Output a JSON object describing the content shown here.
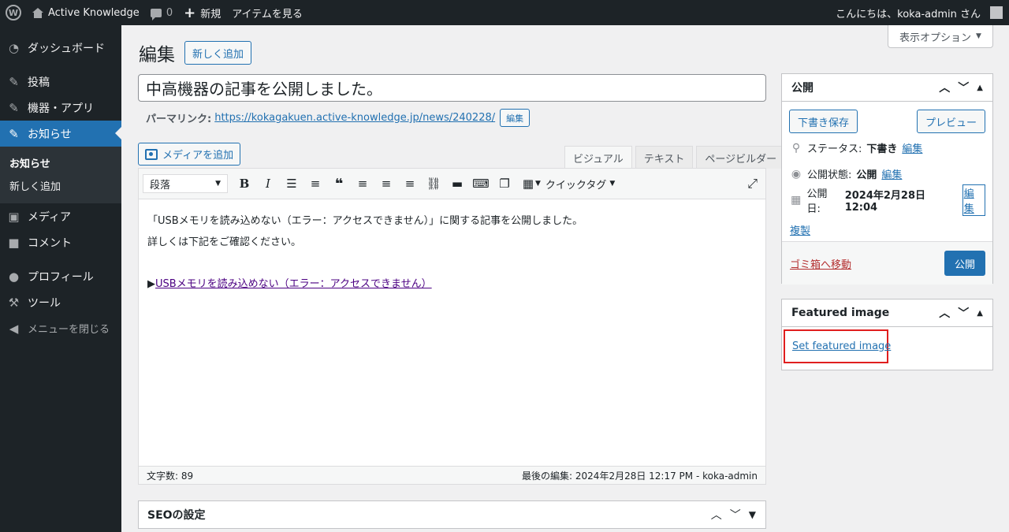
{
  "adminbar": {
    "site_name": "Active Knowledge",
    "comments_count": "0",
    "new_label": "新規",
    "view_label": "アイテムを見る",
    "greeting": "こんにちは、koka-admin さん"
  },
  "sidebar": {
    "items": [
      {
        "label": "ダッシュボード",
        "icon": "dashboard-icon"
      },
      {
        "label": "投稿",
        "icon": "pin-icon"
      },
      {
        "label": "機器・アプリ",
        "icon": "pin-icon"
      },
      {
        "label": "お知らせ",
        "icon": "pin-icon"
      },
      {
        "label": "メディア",
        "icon": "media-icon"
      },
      {
        "label": "コメント",
        "icon": "comment-icon"
      },
      {
        "label": "プロフィール",
        "icon": "user-icon"
      },
      {
        "label": "ツール",
        "icon": "wrench-icon"
      },
      {
        "label": "メニューを閉じる",
        "icon": "collapse-icon"
      }
    ],
    "submenu": [
      "お知らせ",
      "新しく追加"
    ]
  },
  "screen_options": "表示オプション",
  "heading": {
    "title": "編集",
    "add_new": "新しく追加"
  },
  "post": {
    "title": "中高機器の記事を公開しました。",
    "permalink_label": "パーマリンク:",
    "permalink_url": "https://kokagakuen.active-knowledge.jp/news/240228/",
    "permalink_edit": "編集"
  },
  "editor": {
    "media_button": "メディアを追加",
    "tabs": [
      "ビジュアル",
      "テキスト",
      "ページビルダー"
    ],
    "format": "段落",
    "quicktags": "クイックタグ",
    "content_line1": "「USBメモリを読み込めない（エラー：アクセスできません）」に関する記事を公開しました。",
    "content_line2": "詳しくは下記をご確認ください。",
    "link_prefix": "▶",
    "link_text": "USBメモリを読み込めない（エラー：アクセスできません）",
    "word_count": "文字数: 89",
    "last_edited": "最後の編集: 2024年2月28日 12:17 PM - koka-admin"
  },
  "seo_box": {
    "title": "SEOの設定"
  },
  "publish": {
    "title": "公開",
    "save_draft": "下書き保存",
    "preview": "プレビュー",
    "status_label": "ステータス:",
    "status_value": "下書き",
    "visibility_label": "公開状態:",
    "visibility_value": "公開",
    "date_label": "公開日:",
    "date_value": "2024年2月28日 12:04",
    "edit": "編集",
    "duplicate": "複製",
    "trash": "ゴミ箱へ移動",
    "publish_button": "公開"
  },
  "featured_image": {
    "title": "Featured image",
    "set_link": "Set featured image"
  },
  "colors": {
    "accent": "#2271b1",
    "admin_bg": "#1d2327",
    "highlight_border": "#e01e1e",
    "trash": "#b32d2e"
  }
}
